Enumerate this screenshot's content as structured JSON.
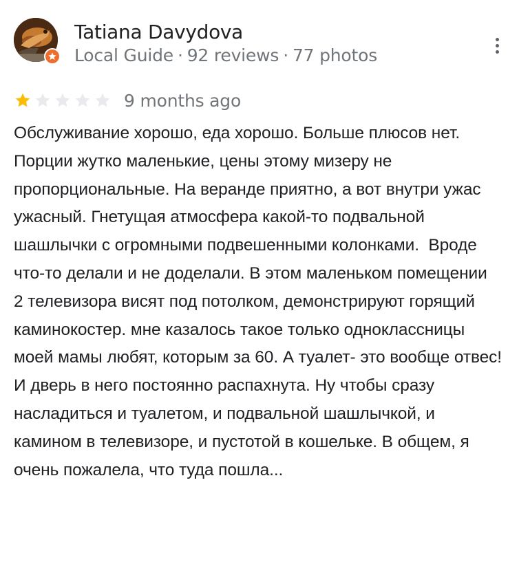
{
  "reviewer": {
    "name": "Tatiana Davydova",
    "badge": "Local Guide",
    "reviews": "92 reviews",
    "photos": "77 photos",
    "separator": "·"
  },
  "rating": {
    "value": 1,
    "max": 5,
    "filled_color": "#fbbc04",
    "empty_color": "#e8eaed"
  },
  "review": {
    "date": "9 months ago",
    "text": "Обслуживание хорошо, еда хорошо. Больше плюсов нет. Порции жутко маленькие, цены этому мизеру не пропорциональные. На веранде приятно, а вот внутри ужас ужасный. Гнетущая атмосфера какой-то подвальной шашлычки с огромными подвешенными колонками.  Вроде что-то делали и не доделали. В этом маленьком помещении  2 телевизора висят под потолком, демонстрируют горящий каминокостер. мне казалось такое только одноклассницы моей мамы любят, которым за 60. А туалет- это вообще отвес! И дверь в него постоянно распахнута. Ну чтобы сразу насладиться и туалетом, и подвальной шашлычкой, и камином в телевизоре, и пустотой в кошельке. В общем, я очень пожалела, что туда пошла..."
  },
  "colors": {
    "text_primary": "#202124",
    "text_secondary": "#70757a",
    "local_guide_badge": "#ee6f2d"
  },
  "icons": {
    "avatar": "user-avatar-photo",
    "badge": "local-guide-star-icon",
    "menu": "more-vert-icon",
    "star": "star-icon"
  }
}
